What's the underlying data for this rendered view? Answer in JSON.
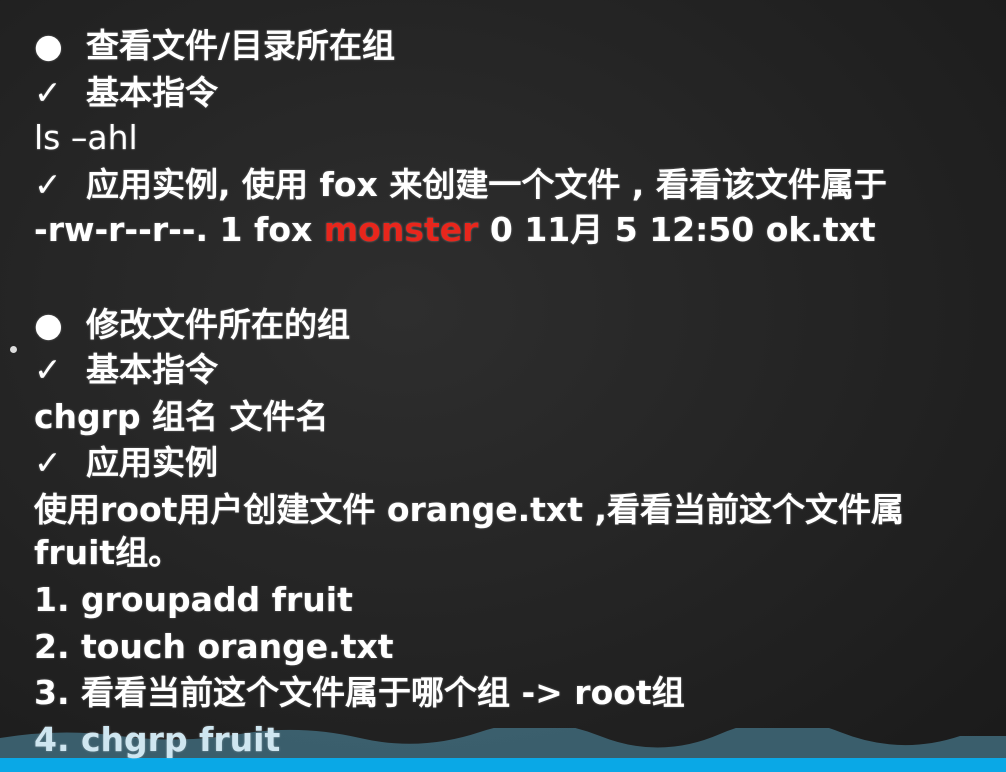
{
  "sections": [
    {
      "bullet": "●",
      "title": "查看文件/目录所在组",
      "basic_check": "✓",
      "basic_label": "基本指令",
      "command": "ls –ahl",
      "example_check": "✓",
      "example_label": "应用实例, 使用 fox 来创建一个文件 , 看看该文件属于",
      "output_prefix": "-rw-r--r--. 1 fox ",
      "output_group": "monster",
      "output_suffix": " 0 11月  5 12:50 ok.txt"
    },
    {
      "bullet": "●",
      "title": "修改文件所在的组",
      "basic_check": "✓",
      "basic_label": "基本指令",
      "command": "chgrp 组名 文件名",
      "example_check": "✓",
      "example_label": "应用实例",
      "description_line1": "使用root用户创建文件 orange.txt ,看看当前这个文件属",
      "description_line2": "fruit组。",
      "steps": [
        "1. groupadd fruit",
        "2. touch orange.txt",
        "3. 看看当前这个文件属于哪个组 -> root组",
        "4. chgrp fruit"
      ]
    }
  ],
  "colors": {
    "highlight": "#e8261c",
    "text": "#ffffff",
    "taskbar": "#0aa8e6"
  }
}
